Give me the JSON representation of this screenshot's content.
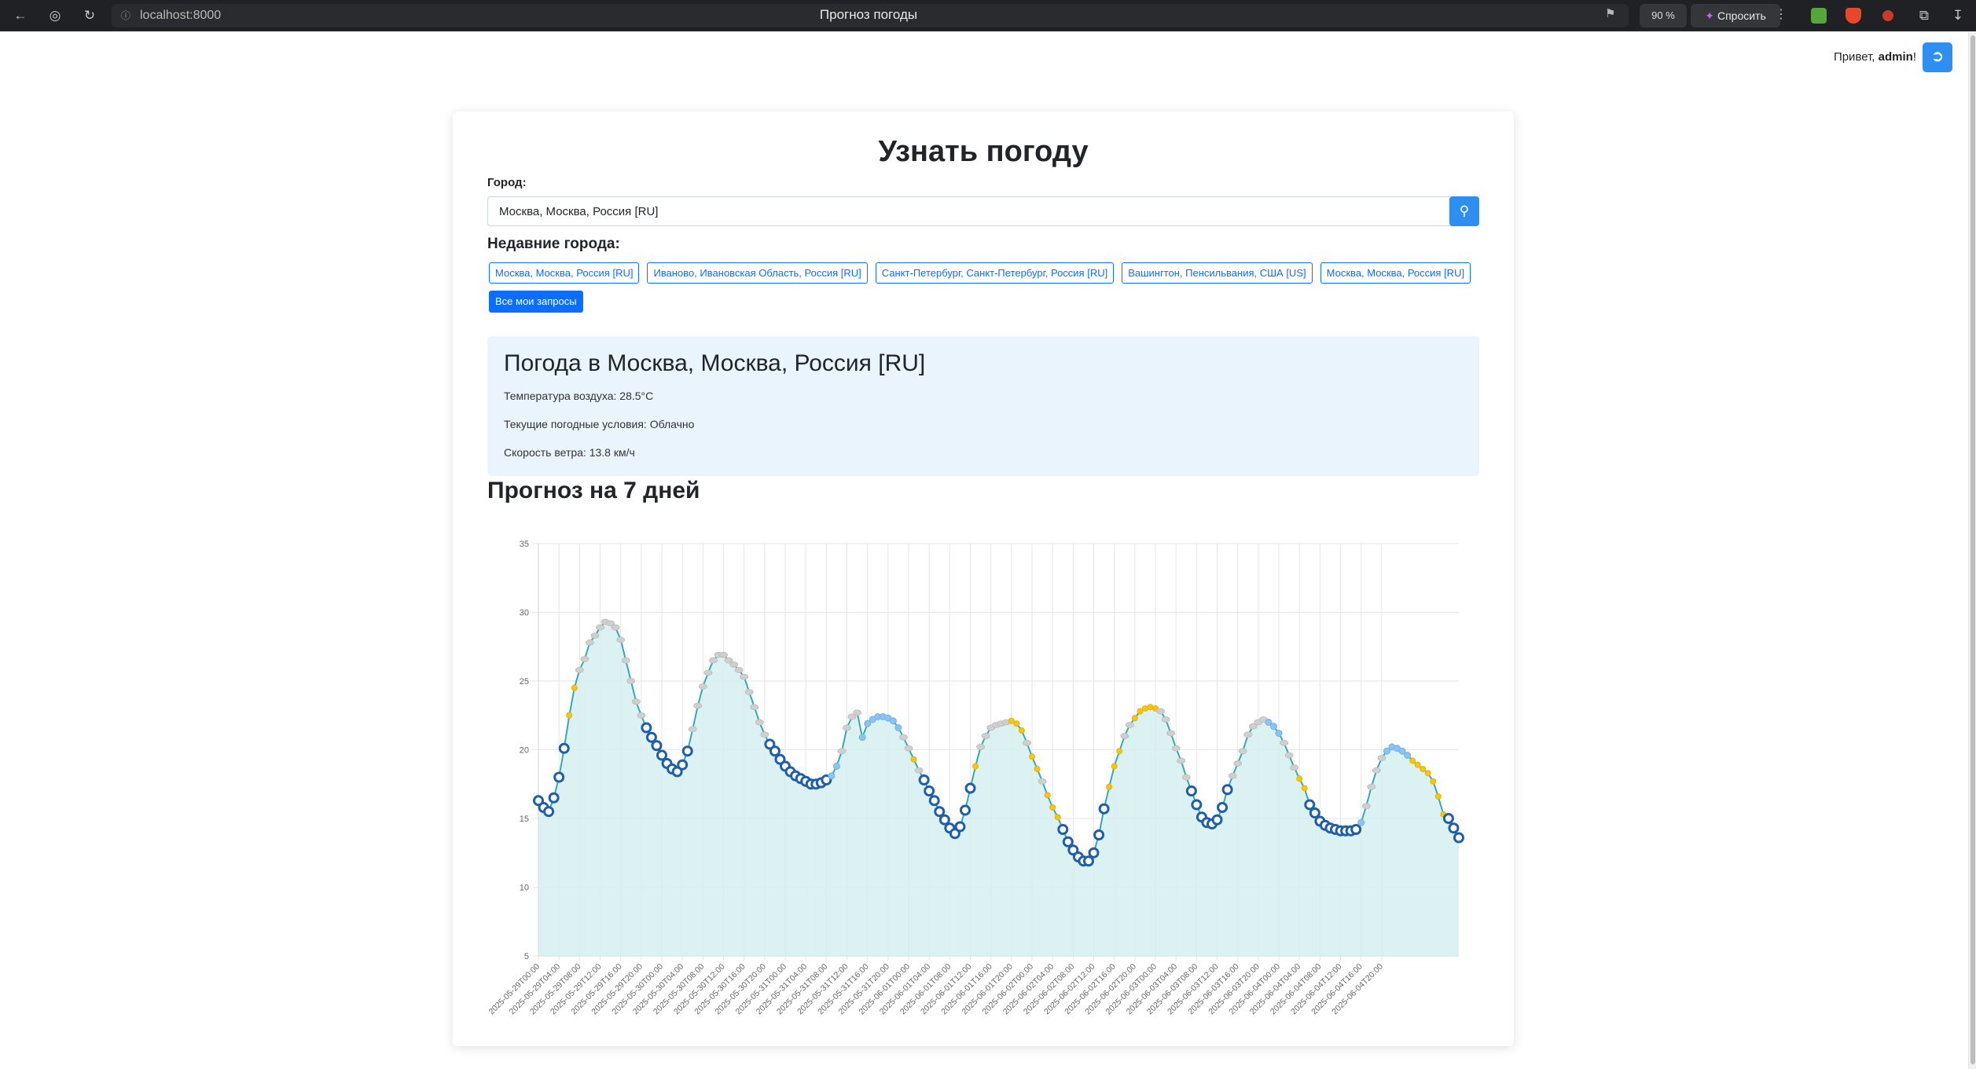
{
  "browser": {
    "address": "localhost:8000",
    "tab_title": "Прогноз погоды",
    "zoom": "90 %",
    "ask_label": "Спросить"
  },
  "header": {
    "greeting_prefix": "Привет, ",
    "username": "admin",
    "greeting_suffix": "!"
  },
  "page": {
    "title": "Узнать погоду",
    "city_label": "Город:",
    "city_value": "Москва, Москва, Россия [RU]",
    "recent_title": "Недавние города:",
    "recent_cities": [
      "Москва, Москва, Россия [RU]",
      "Иваново, Ивановская Область, Россия [RU]",
      "Санкт-Петербург, Санкт-Петербург, Россия [RU]",
      "Вашингтон, Пенсильвания, США [US]",
      "Москва, Москва, Россия [RU]"
    ],
    "all_requests_label": "Все мои запросы"
  },
  "current": {
    "title": "Погода в Москва, Москва, Россия [RU]",
    "temperature": "Температура воздуха: 28.5°C",
    "conditions": "Текущие погодные условия: Облачно",
    "wind": "Скорость ветра: 13.8 км/ч"
  },
  "forecast": {
    "title": "Прогноз на 7 дней"
  },
  "colors": {
    "line": "#36a9b5",
    "fill": "#d6efef",
    "night_point": "#1f5fa8",
    "cloudy_point": "#cfcfcf",
    "sunny_point": "#f5c518",
    "rain_point": "#8cc4f0",
    "accent": "#2f8ff0"
  },
  "chart_data": {
    "type": "line",
    "ylim": [
      5,
      35
    ],
    "yticks": [
      5,
      10,
      15,
      20,
      25,
      30,
      35
    ],
    "x_start": "2025-05-29T00:00",
    "step_hours": 1,
    "x_tick_labels": [
      "2025-05-29T00:00",
      "2025-05-29T04:00",
      "2025-05-29T08:00",
      "2025-05-29T12:00",
      "2025-05-29T16:00",
      "2025-05-29T20:00",
      "2025-05-30T00:00",
      "2025-05-30T04:00",
      "2025-05-30T08:00",
      "2025-05-30T12:00",
      "2025-05-30T16:00",
      "2025-05-30T20:00",
      "2025-05-31T00:00",
      "2025-05-31T04:00",
      "2025-05-31T08:00",
      "2025-05-31T12:00",
      "2025-05-31T16:00",
      "2025-05-31T20:00",
      "2025-06-01T00:00",
      "2025-06-01T04:00",
      "2025-06-01T08:00",
      "2025-06-01T12:00",
      "2025-06-01T16:00",
      "2025-06-01T20:00",
      "2025-06-02T00:00",
      "2025-06-02T04:00",
      "2025-06-02T08:00",
      "2025-06-02T12:00",
      "2025-06-02T16:00",
      "2025-06-02T20:00",
      "2025-06-03T00:00",
      "2025-06-03T04:00",
      "2025-06-03T08:00",
      "2025-06-03T12:00",
      "2025-06-03T16:00",
      "2025-06-03T20:00",
      "2025-06-04T00:00",
      "2025-06-04T04:00",
      "2025-06-04T08:00",
      "2025-06-04T12:00",
      "2025-06-04T16:00",
      "2025-06-04T20:00"
    ],
    "values": [
      16.3,
      15.8,
      15.5,
      16.5,
      18.0,
      20.1,
      22.5,
      24.5,
      25.8,
      26.6,
      27.8,
      28.3,
      28.9,
      29.3,
      29.2,
      28.9,
      28.0,
      26.5,
      25.0,
      23.5,
      22.5,
      21.6,
      20.9,
      20.3,
      19.6,
      19.0,
      18.6,
      18.4,
      18.9,
      19.9,
      21.5,
      23.2,
      24.6,
      25.6,
      26.5,
      26.9,
      26.9,
      26.5,
      26.2,
      25.8,
      25.3,
      24.2,
      23.1,
      22.0,
      21.1,
      20.4,
      19.9,
      19.3,
      18.8,
      18.4,
      18.1,
      17.9,
      17.7,
      17.5,
      17.5,
      17.6,
      17.8,
      18.1,
      18.8,
      19.9,
      21.6,
      22.4,
      22.7,
      20.9,
      21.9,
      22.2,
      22.4,
      22.4,
      22.3,
      22.1,
      21.6,
      20.9,
      20.1,
      19.3,
      18.5,
      17.8,
      17.0,
      16.3,
      15.5,
      14.9,
      14.3,
      13.9,
      14.4,
      15.6,
      17.2,
      18.8,
      20.2,
      21.0,
      21.6,
      21.8,
      21.9,
      22.0,
      22.1,
      21.9,
      21.4,
      20.5,
      19.5,
      18.6,
      17.7,
      16.7,
      15.8,
      15.1,
      14.2,
      13.3,
      12.7,
      12.2,
      11.9,
      11.9,
      12.5,
      13.8,
      15.7,
      17.3,
      18.8,
      19.9,
      21.0,
      21.8,
      22.3,
      22.8,
      23.0,
      23.1,
      23.0,
      22.8,
      22.2,
      21.2,
      20.1,
      19.2,
      18.0,
      17.0,
      16.0,
      15.1,
      14.7,
      14.6,
      14.9,
      15.8,
      17.1,
      18.1,
      19.0,
      19.9,
      21.1,
      21.7,
      22.0,
      22.2,
      22.0,
      21.7,
      21.2,
      20.5,
      19.6,
      18.7,
      17.9,
      17.2,
      16.0,
      15.4,
      14.8,
      14.5,
      14.3,
      14.2,
      14.1,
      14.1,
      14.1,
      14.2,
      14.7,
      15.9,
      17.3,
      18.5,
      19.4,
      19.9,
      20.2,
      20.1,
      19.9,
      19.6,
      19.2,
      18.9,
      18.6,
      18.3,
      17.7,
      16.6,
      15.3,
      15.0,
      14.3,
      13.6
    ],
    "point_kinds": [
      "n",
      "n",
      "n",
      "n",
      "n",
      "n",
      "s",
      "s",
      "c",
      "c",
      "c",
      "c",
      "c",
      "c",
      "c",
      "c",
      "c",
      "c",
      "c",
      "c",
      "c",
      "n",
      "n",
      "n",
      "n",
      "n",
      "n",
      "n",
      "n",
      "n",
      "c",
      "c",
      "c",
      "c",
      "c",
      "c",
      "c",
      "c",
      "c",
      "c",
      "c",
      "c",
      "c",
      "c",
      "c",
      "n",
      "n",
      "n",
      "n",
      "n",
      "n",
      "n",
      "n",
      "n",
      "n",
      "n",
      "n",
      "r",
      "r",
      "c",
      "c",
      "c",
      "c",
      "r",
      "r",
      "r",
      "r",
      "r",
      "r",
      "r",
      "r",
      "c",
      "c",
      "s",
      "c",
      "n",
      "n",
      "n",
      "n",
      "n",
      "n",
      "n",
      "n",
      "n",
      "n",
      "s",
      "c",
      "c",
      "c",
      "c",
      "c",
      "c",
      "s",
      "s",
      "s",
      "c",
      "s",
      "s",
      "c",
      "s",
      "s",
      "s",
      "n",
      "n",
      "n",
      "n",
      "n",
      "n",
      "n",
      "n",
      "n",
      "s",
      "s",
      "s",
      "c",
      "c",
      "s",
      "s",
      "s",
      "s",
      "s",
      "c",
      "c",
      "c",
      "c",
      "c",
      "c",
      "n",
      "n",
      "n",
      "n",
      "n",
      "n",
      "n",
      "n",
      "c",
      "c",
      "c",
      "c",
      "c",
      "c",
      "c",
      "r",
      "r",
      "r",
      "c",
      "c",
      "c",
      "s",
      "s",
      "n",
      "n",
      "n",
      "n",
      "n",
      "n",
      "n",
      "n",
      "n",
      "n",
      "r",
      "c",
      "c",
      "c",
      "c",
      "r",
      "r",
      "r",
      "r",
      "r",
      "s",
      "s",
      "s",
      "s",
      "s",
      "s",
      "s",
      "n",
      "n",
      "n"
    ]
  }
}
